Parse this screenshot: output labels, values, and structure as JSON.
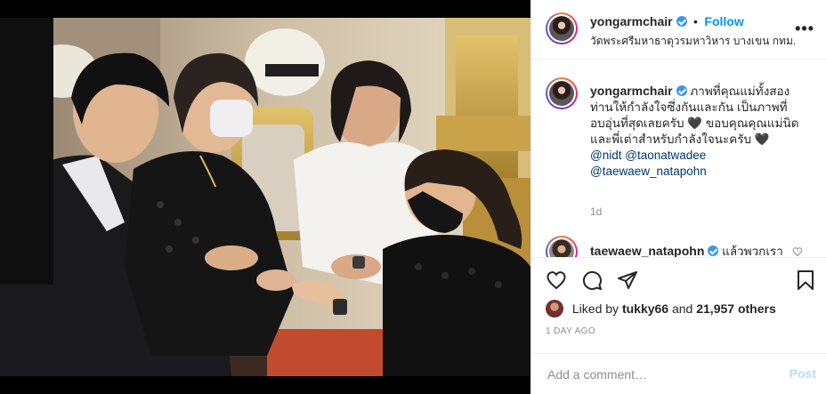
{
  "post": {
    "username": "yongarmchair",
    "follow_label": "Follow",
    "separator": "•",
    "location": "วัดพระศรีมหาธาตุวรมหาวิหาร บางเขน กทม.",
    "more_glyph": "•••"
  },
  "caption": {
    "username": "yongarmchair",
    "text": "ภาพที่คุณแม่ทั้งสองท่านให้กำลังใจซึ่งกันและกัน เป็นภาพที่อบอุ่นที่สุดเลยครับ 🖤 ขอบคุณคุณแม่นิดและพี่เต่าสำหรับกำลังใจนะครับ 🖤",
    "mentions": [
      "@nidt",
      "@taonatwadee",
      "@taewaew_natapohn"
    ],
    "time": "1d"
  },
  "comment": {
    "username": "taewaew_natapohn",
    "text": "แล้วพวกเรา"
  },
  "actions": {
    "icons": [
      "heart-icon",
      "comment-icon",
      "share-icon",
      "save-icon"
    ]
  },
  "likes": {
    "prefix": "Liked by",
    "user": "tukky66",
    "middle": "and",
    "count": "21,957 others"
  },
  "date": "1 DAY AGO",
  "add_comment": {
    "placeholder": "Add a comment…",
    "post_label": "Post"
  },
  "colors": {
    "link": "#0095f6",
    "mention": "#00376b",
    "muted": "#8e8e8e",
    "verified": "#3897f0"
  }
}
